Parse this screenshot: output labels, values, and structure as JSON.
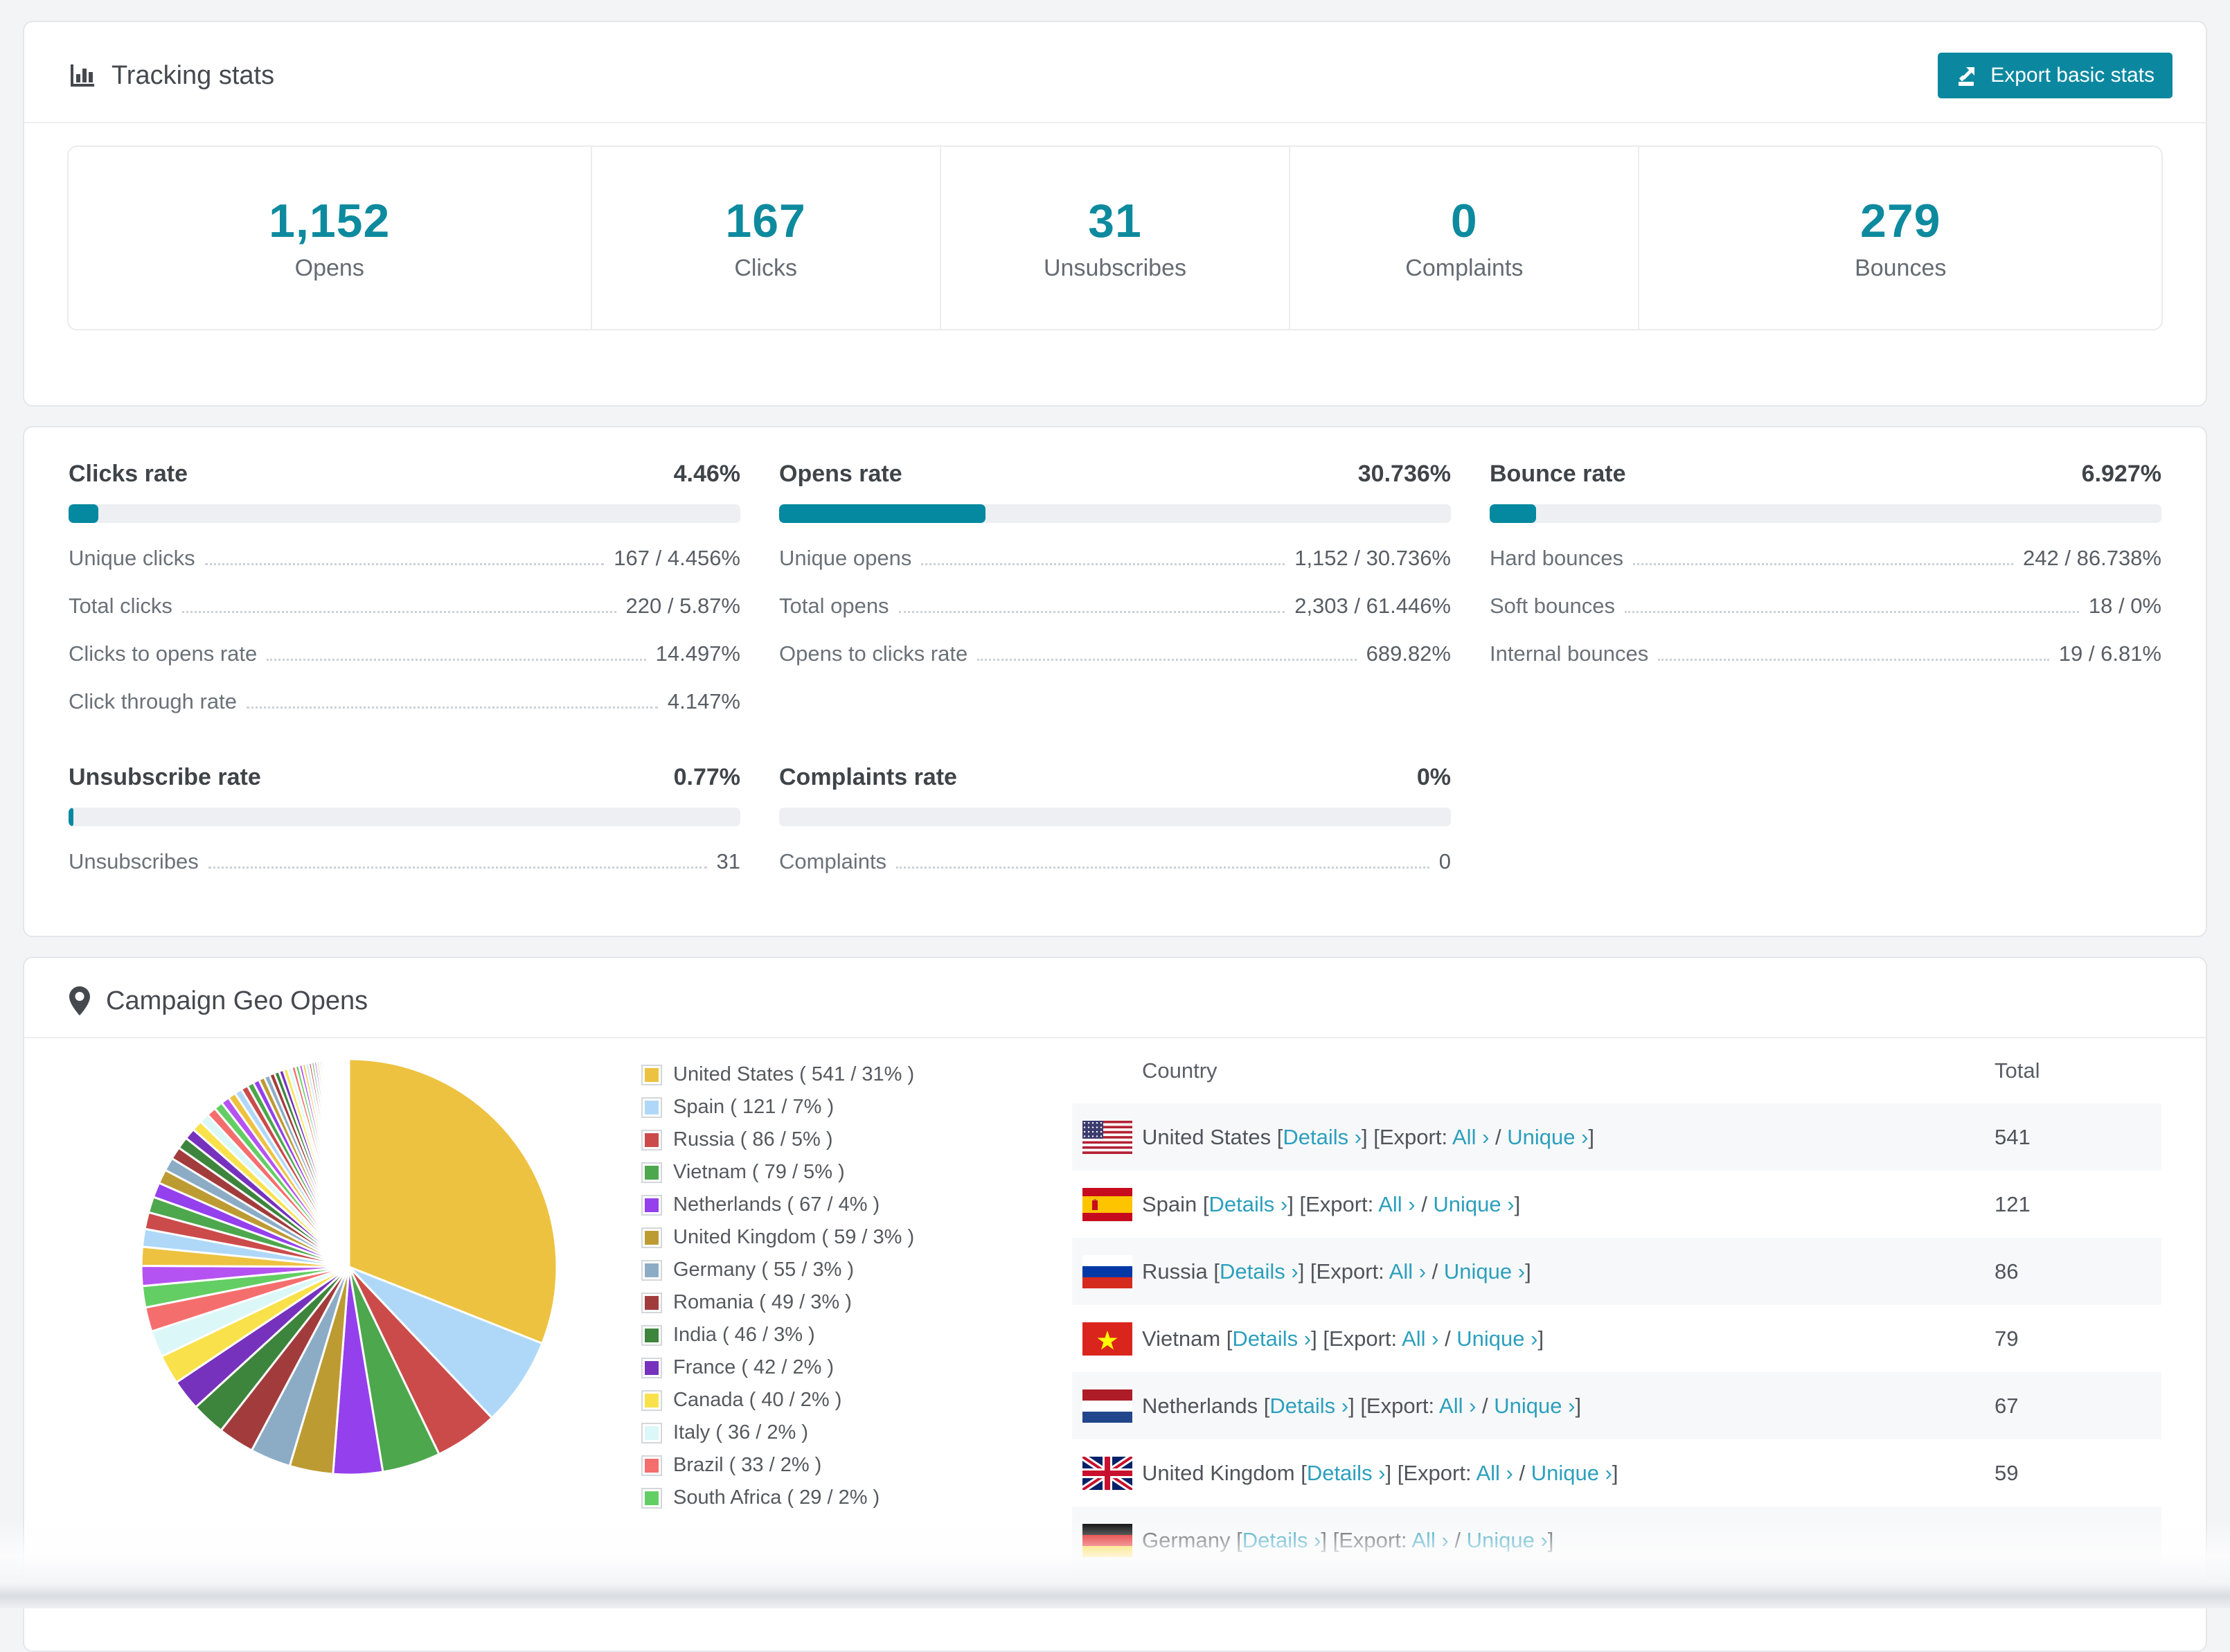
{
  "page": {
    "accent_color": "#0b88a0",
    "link_color": "#2c9fbd",
    "background": "#f3f4f6"
  },
  "tracking": {
    "title": "Tracking stats",
    "export_button": "Export basic stats",
    "summary": [
      {
        "value": "1,152",
        "label": "Opens"
      },
      {
        "value": "167",
        "label": "Clicks"
      },
      {
        "value": "31",
        "label": "Unsubscribes"
      },
      {
        "value": "0",
        "label": "Complaints"
      },
      {
        "value": "279",
        "label": "Bounces"
      }
    ]
  },
  "rates": [
    {
      "title": "Clicks rate",
      "value": "4.46%",
      "percent": 4.46,
      "rows": [
        {
          "label": "Unique clicks",
          "value": "167 / 4.456%"
        },
        {
          "label": "Total clicks",
          "value": "220 / 5.87%"
        },
        {
          "label": "Clicks to opens rate",
          "value": "14.497%"
        },
        {
          "label": "Click through rate",
          "value": "4.147%"
        }
      ]
    },
    {
      "title": "Opens rate",
      "value": "30.736%",
      "percent": 30.736,
      "rows": [
        {
          "label": "Unique opens",
          "value": "1,152 / 30.736%"
        },
        {
          "label": "Total opens",
          "value": "2,303 / 61.446%"
        },
        {
          "label": "Opens to clicks rate",
          "value": "689.82%"
        }
      ]
    },
    {
      "title": "Bounce rate",
      "value": "6.927%",
      "percent": 6.927,
      "rows": [
        {
          "label": "Hard bounces",
          "value": "242 / 86.738%"
        },
        {
          "label": "Soft bounces",
          "value": "18 / 0%"
        },
        {
          "label": "Internal bounces",
          "value": "19 / 6.81%"
        }
      ]
    },
    {
      "title": "Unsubscribe rate",
      "value": "0.77%",
      "percent": 0.77,
      "rows": [
        {
          "label": "Unsubscribes",
          "value": "31"
        }
      ]
    },
    {
      "title": "Complaints rate",
      "value": "0%",
      "percent": 0,
      "rows": [
        {
          "label": "Complaints",
          "value": "0"
        }
      ]
    }
  ],
  "geo": {
    "title": "Campaign Geo Opens",
    "chart_data": {
      "type": "pie",
      "title": "Campaign Geo Opens",
      "start_angle": "top",
      "direction": "clockwise",
      "legend_position": "right",
      "series": [
        {
          "name": "United States",
          "value": 541,
          "pct": "31%",
          "color": "#edc240"
        },
        {
          "name": "Spain",
          "value": 121,
          "pct": "7%",
          "color": "#afd8f8"
        },
        {
          "name": "Russia",
          "value": 86,
          "pct": "5%",
          "color": "#cb4b4b"
        },
        {
          "name": "Vietnam",
          "value": 79,
          "pct": "5%",
          "color": "#4da74d"
        },
        {
          "name": "Netherlands",
          "value": 67,
          "pct": "4%",
          "color": "#9440ed"
        },
        {
          "name": "United Kingdom",
          "value": 59,
          "pct": "3%",
          "color": "#bd9b33"
        },
        {
          "name": "Germany",
          "value": 55,
          "pct": "3%",
          "color": "#8cacc6"
        },
        {
          "name": "Romania",
          "value": 49,
          "pct": "3%",
          "color": "#a23c3c"
        },
        {
          "name": "India",
          "value": 46,
          "pct": "3%",
          "color": "#3d853d"
        },
        {
          "name": "France",
          "value": 42,
          "pct": "2%",
          "color": "#7632bd"
        },
        {
          "name": "Canada",
          "value": 40,
          "pct": "2%",
          "color": "#f9e14c"
        },
        {
          "name": "Italy",
          "value": 36,
          "pct": "2%",
          "color": "#dcf7f7"
        },
        {
          "name": "Brazil",
          "value": 33,
          "pct": "2%",
          "color": "#f56e6e"
        },
        {
          "name": "South Africa",
          "value": 29,
          "pct": "2%",
          "color": "#63ce63"
        }
      ],
      "unlabeled_tail": {
        "estimated_total": 462,
        "slice_count": 60,
        "decay": 0.943,
        "palette": [
          "#b553f2",
          "#edc240",
          "#afd8f8",
          "#cb4b4b",
          "#4da74d",
          "#9440ed",
          "#bd9b33",
          "#8cacc6",
          "#a23c3c",
          "#3d853d",
          "#7632bd",
          "#f9e14c",
          "#dcf7f7",
          "#f56e6e",
          "#63ce63"
        ]
      }
    },
    "legend_format": {
      "open": "( ",
      "sep": " / ",
      "close": " )"
    },
    "table": {
      "headers": [
        "Country",
        "Total"
      ],
      "links": {
        "details": "Details ›",
        "export_prefix": "Export:",
        "all": "All ›",
        "unique": "Unique ›"
      },
      "rows": [
        {
          "country": "United States",
          "flag": "us",
          "total": "541"
        },
        {
          "country": "Spain",
          "flag": "es",
          "total": "121"
        },
        {
          "country": "Russia",
          "flag": "ru",
          "total": "86"
        },
        {
          "country": "Vietnam",
          "flag": "vn",
          "total": "79"
        },
        {
          "country": "Netherlands",
          "flag": "nl",
          "total": "67"
        },
        {
          "country": "United Kingdom",
          "flag": "gb",
          "total": "59"
        },
        {
          "country": "Germany",
          "flag": "de",
          "total": ""
        }
      ]
    }
  }
}
